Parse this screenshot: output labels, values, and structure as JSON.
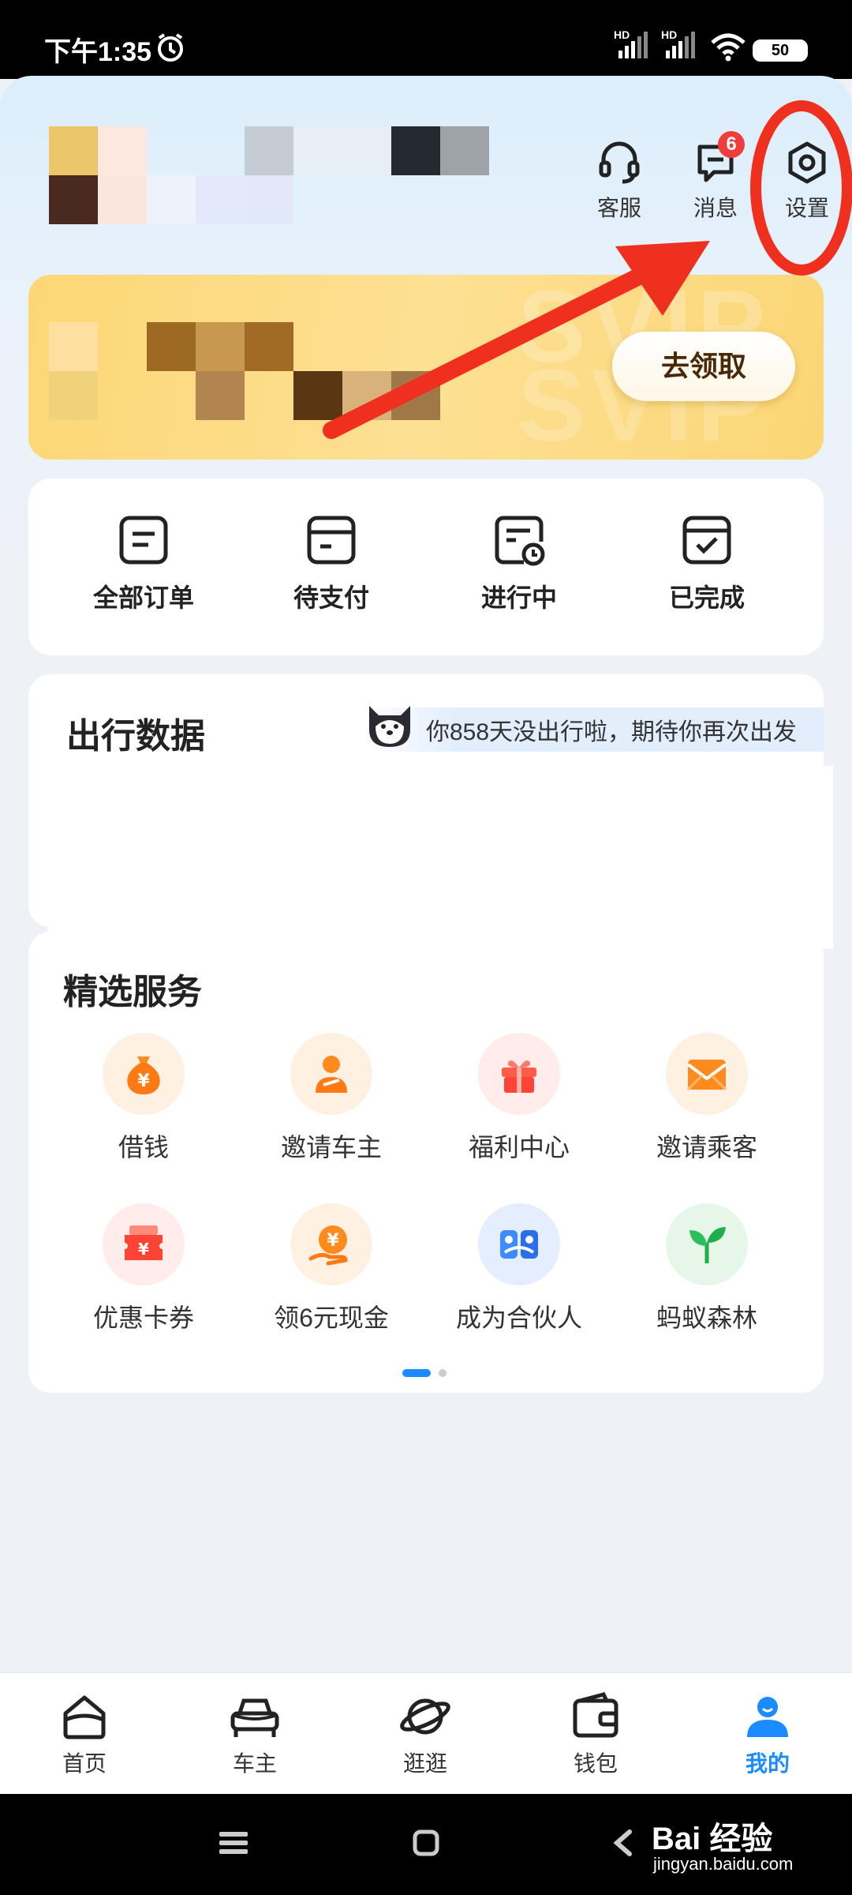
{
  "status_bar": {
    "time": "下午1:35",
    "network_1": "HD",
    "network_2": "HD",
    "battery": "50"
  },
  "header": {
    "actions": [
      {
        "label": "客服",
        "icon": "headset-icon"
      },
      {
        "label": "消息",
        "icon": "message-icon",
        "badge": "6"
      },
      {
        "label": "设置",
        "icon": "settings-icon"
      }
    ]
  },
  "vip_banner": {
    "watermark": "SVIP",
    "button_label": "去领取"
  },
  "orders": [
    {
      "label": "全部订单",
      "icon": "all-orders-icon"
    },
    {
      "label": "待支付",
      "icon": "pending-payment-icon"
    },
    {
      "label": "进行中",
      "icon": "in-progress-icon"
    },
    {
      "label": "已完成",
      "icon": "completed-icon"
    }
  ],
  "travel_data": {
    "title": "出行数据",
    "tip": "你858天没出行啦，期待你再次出发"
  },
  "services": {
    "title": "精选服务",
    "items": [
      {
        "label": "借钱",
        "icon": "money-bag-icon"
      },
      {
        "label": "邀请车主",
        "icon": "invite-driver-icon"
      },
      {
        "label": "福利中心",
        "icon": "gift-icon"
      },
      {
        "label": "邀请乘客",
        "icon": "envelope-icon"
      },
      {
        "label": "优惠卡券",
        "icon": "coupon-icon"
      },
      {
        "label": "领6元现金",
        "icon": "cash-icon"
      },
      {
        "label": "成为合伙人",
        "icon": "partner-icon"
      },
      {
        "label": "蚂蚁森林",
        "icon": "leaf-icon"
      }
    ],
    "page_count": 2,
    "active_page": 1
  },
  "bottom_nav": {
    "items": [
      {
        "label": "首页",
        "icon": "home-icon"
      },
      {
        "label": "车主",
        "icon": "car-icon"
      },
      {
        "label": "逛逛",
        "icon": "planet-icon"
      },
      {
        "label": "钱包",
        "icon": "wallet-icon"
      },
      {
        "label": "我的",
        "icon": "profile-icon"
      }
    ],
    "active": "我的"
  },
  "watermark": {
    "brand": "Bai 经验",
    "url": "jingyan.baidu.com"
  },
  "colors": {
    "accent_blue": "#1a8cff",
    "annotation_red": "#f0301e",
    "badge_red": "#f23c3c",
    "vip_gold": "#fdd776"
  }
}
